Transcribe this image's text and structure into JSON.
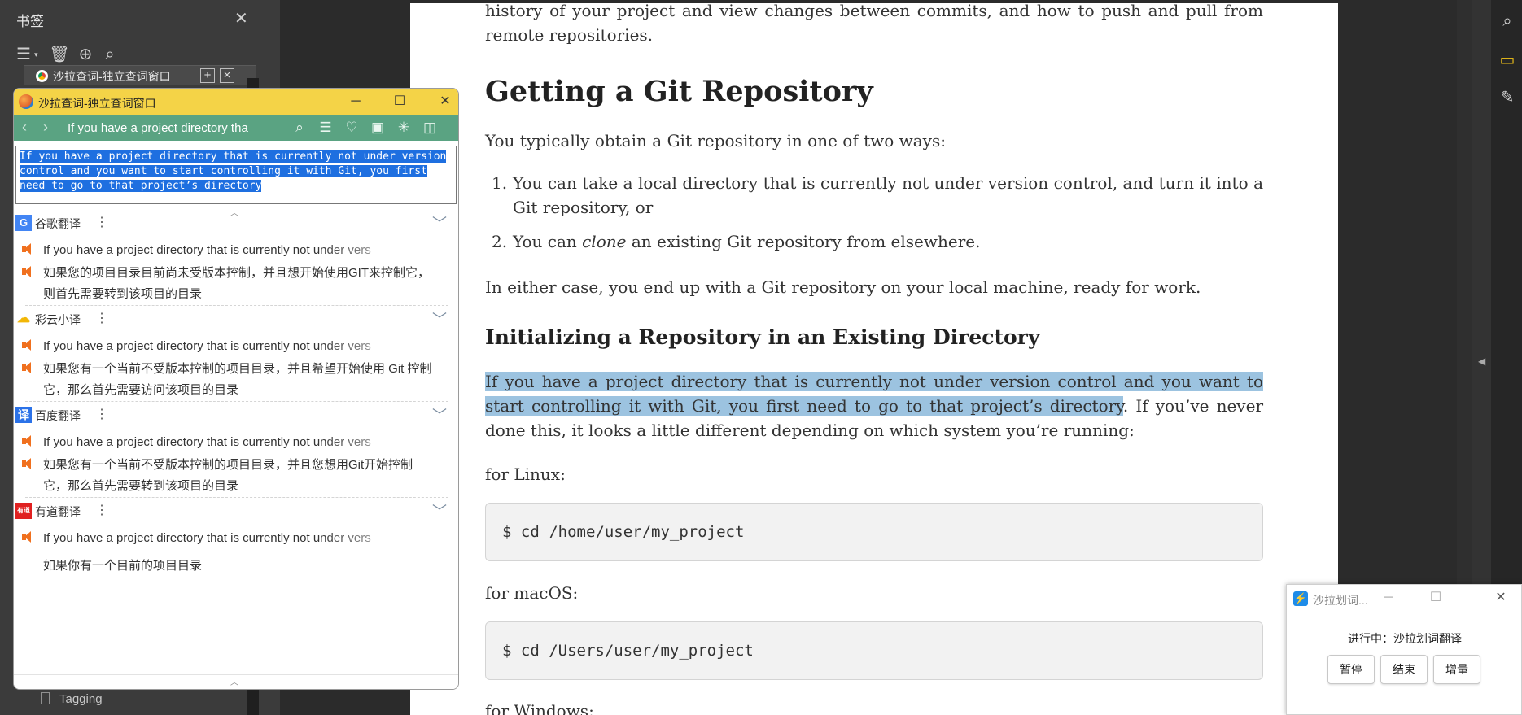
{
  "bookmarks": {
    "title": "书签",
    "close_icon": "close-icon",
    "tab_label": "沙拉查词-独立查词窗口",
    "bottom_item": "Tagging",
    "tools": [
      "list-view-icon",
      "delete-icon",
      "add-bookmark-icon",
      "bookmark-search-icon"
    ]
  },
  "sala": {
    "title": "沙拉查词-独立查词窗口",
    "query": "If you have a project directory tha",
    "source_text": "If you have a project directory that is currently not under version control and you want to start controlling it with Git, you first need to go to that project’s directory",
    "engines": [
      {
        "name": "谷歌翻译",
        "logo": "G",
        "color": "#4285f4",
        "source": "If you have a project directory that is currently not under vers",
        "result": "如果您的项目目录目前尚未受版本控制，并且想开始使用GIT来控制它，则首先需要转到该项目的目录"
      },
      {
        "name": "彩云小译",
        "logo": "cloud-icon",
        "color": "#f2b707",
        "source": "If you have a project directory that is currently not under vers",
        "result": "如果您有一个当前不受版本控制的项目目录，并且希望开始使用 Git 控制它，那么首先需要访问该项目的目录"
      },
      {
        "name": "百度翻译",
        "logo": "译",
        "color": "#2b72e8",
        "source": "If you have a project directory that is currently not under vers",
        "result": "如果您有一个当前不受版本控制的项目目录，并且您想用Git开始控制它，那么首先需要转到该项目的目录"
      },
      {
        "name": "有道翻译",
        "logo": "有道",
        "color": "#e02020",
        "source": "If you have a project directory that is currently not under vers",
        "result": "如果你有一个目前的项目目录"
      }
    ]
  },
  "doc": {
    "intro": "history of your project and view changes between commits, and how to push and pull from remote repositories.",
    "h2": "Getting a Git Repository",
    "obtain": "You typically obtain a Git repository in one of two ways:",
    "li1_num": "1.",
    "li1": "You can take a local directory that is currently not under version control, and turn it into a Git repository, or",
    "li2_num": "2.",
    "li2_pre": "You can ",
    "li2_em": "clone",
    "li2_post": " an existing Git repository from elsewhere.",
    "either": "In either case, you end up with a Git repository on your local machine, ready for work.",
    "h3": "Initializing a Repository in an Existing Directory",
    "init_highlight": "If you have a project directory that is currently not under version control and you want to start controlling it with Git, you first need to go to that project’s directory",
    "init_rest": ". If you’ve never done this, it looks a little different depending on which system you’re running:",
    "linux_label": "for Linux:",
    "linux_cmd": "$ cd /home/user/my_project",
    "mac_label": "for macOS:",
    "mac_cmd": "$ cd /Users/user/my_project",
    "win_label": "for Windows:"
  },
  "right_bar": {
    "icons": [
      "zoom-search-icon",
      "comment-icon",
      "tools-icon"
    ],
    "accent": "#f2c318"
  },
  "mini": {
    "title": "沙拉划词...",
    "status": "进行中：沙拉划词翻译",
    "buttons": [
      "暂停",
      "结束",
      "增量"
    ]
  }
}
